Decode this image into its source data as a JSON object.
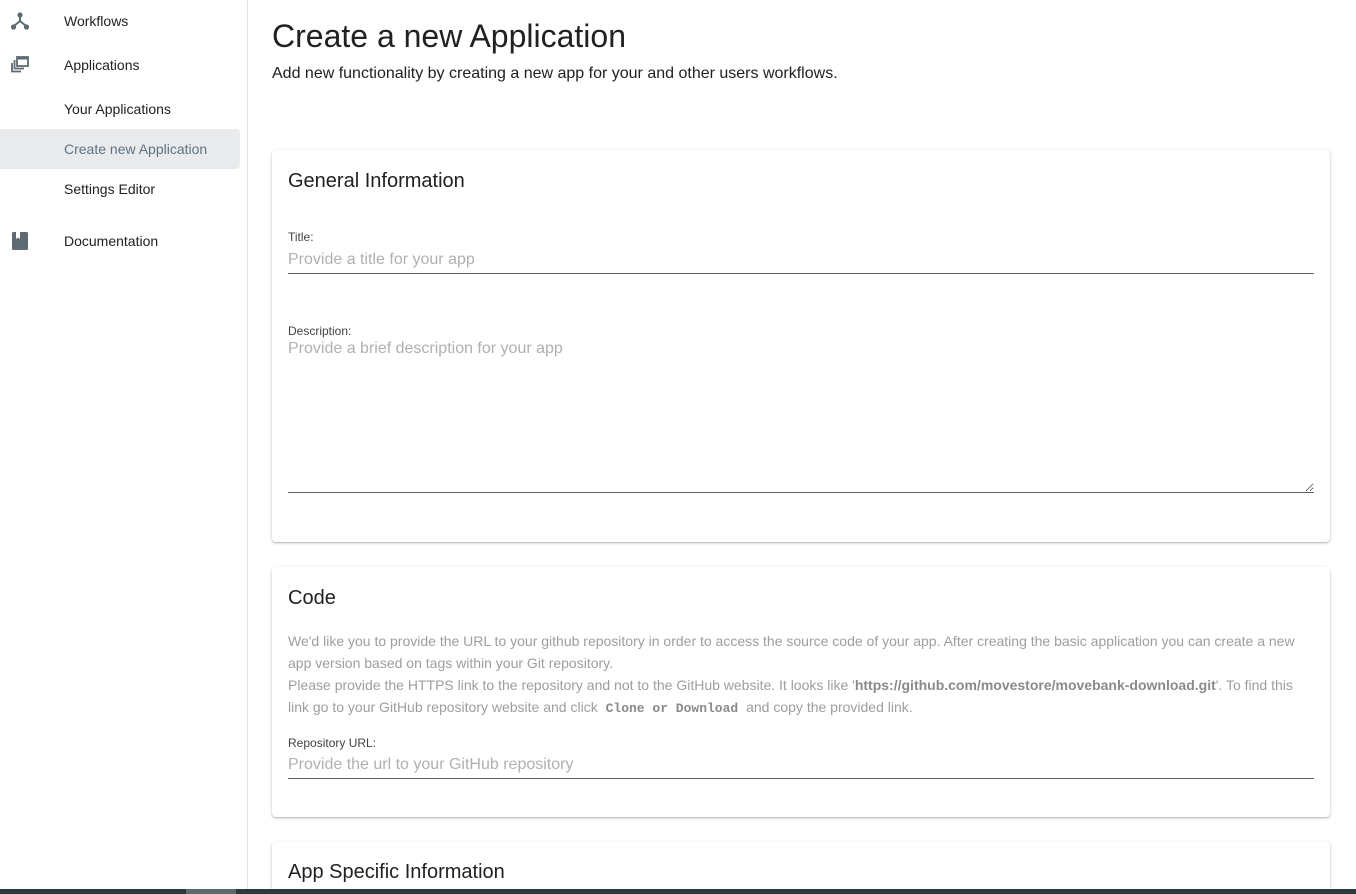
{
  "sidebar": {
    "items": [
      {
        "label": "Workflows",
        "icon": "workflow-icon"
      },
      {
        "label": "Applications",
        "icon": "applications-icon"
      },
      {
        "label": "Your Applications"
      },
      {
        "label": "Create new Application",
        "active": true
      },
      {
        "label": "Settings Editor"
      },
      {
        "label": "Documentation",
        "icon": "book-icon"
      }
    ]
  },
  "header": {
    "title": "Create a new Application",
    "subtitle": "Add new functionality by creating a new app for your and other users workflows."
  },
  "general": {
    "title": "General Information",
    "title_label": "Title:",
    "title_placeholder": "Provide a title for your app",
    "description_label": "Description:",
    "description_placeholder": "Provide a brief description for your app"
  },
  "code": {
    "title": "Code",
    "help_line1": "We'd like you to provide the URL to your github repository in order to access the source code of your app. After creating the basic application you can create a new app version based on tags within your Git repository.",
    "help_line2_pre": "Please provide the HTTPS link to the repository and not to the GitHub website. It looks like '",
    "help_link_example": "https://github.com/movestore/movebank-download.git",
    "help_line2_mid": "'. To find this link go to your GitHub repository website and click ",
    "help_button_name": "Clone or Download",
    "help_line2_post": " and copy the provided link.",
    "repo_label": "Repository URL:",
    "repo_placeholder": "Provide the url to your GitHub repository"
  },
  "app_specific": {
    "title": "App Specific Information"
  },
  "colors": {
    "active_bg": "#e8eaec",
    "icon": "#5f6b72",
    "bottom_bar": "#2b3a3e"
  }
}
